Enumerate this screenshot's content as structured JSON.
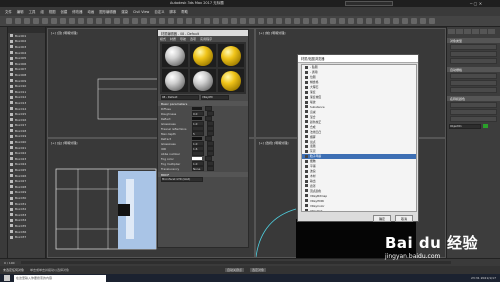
{
  "window": {
    "title": "Autodesk 3ds Max 2017   无标题",
    "search_placeholder": "键入关键字或短语"
  },
  "menu": [
    "文件",
    "编辑",
    "工具",
    "组",
    "视图",
    "创建",
    "修改器",
    "动画",
    "图形编辑器",
    "渲染",
    "Civil View",
    "自定义",
    "脚本",
    "帮助"
  ],
  "scene_explorer": {
    "items": [
      "Box001",
      "Box002",
      "Box003",
      "Box004",
      "Box005",
      "Box006",
      "Box007",
      "Box008",
      "Box009",
      "Box010",
      "Box011",
      "Box012",
      "Box013",
      "Box014",
      "Box015",
      "Box016",
      "Box017",
      "Box018",
      "Box019",
      "Box020",
      "Box021",
      "Box022",
      "Box023",
      "Box024",
      "Box025",
      "Box026",
      "Box027",
      "Box028",
      "Box029",
      "Box030",
      "Box031",
      "Box032",
      "Box033",
      "Box034",
      "Box035",
      "Box036",
      "Box037"
    ]
  },
  "viewports": {
    "top": "[+] [顶] [明暗处理]",
    "front": "[+] [前] [明暗处理]",
    "left": "[+] [左] [明暗处理]",
    "perspective": "[+] [透视] [明暗处理]"
  },
  "material_editor": {
    "title": "材质编辑器 - 08 - Default",
    "menu": [
      "模式",
      "材质",
      "导航",
      "选项",
      "实用程序"
    ],
    "slots": [
      "gray",
      "gold",
      "gold",
      "gray",
      "gray",
      "gold"
    ],
    "material_name": "08 - Default",
    "material_type": "VRayMtl",
    "rollout_basic": "Basic parameters",
    "params": [
      {
        "label": "Diffuse",
        "value": "",
        "swatch": "#1a1a1a"
      },
      {
        "label": "Roughness",
        "value": "0.0"
      },
      {
        "label": "Reflect",
        "value": "",
        "swatch": "#111111"
      },
      {
        "label": "Glossiness",
        "value": "1.0"
      },
      {
        "label": "Fresnel reflections",
        "value": ""
      },
      {
        "label": "Max depth",
        "value": "5"
      },
      {
        "label": "Refract",
        "value": "",
        "swatch": "#101010"
      },
      {
        "label": "Glossiness",
        "value": "1.0"
      },
      {
        "label": "IOR",
        "value": "1.6"
      },
      {
        "label": "Abbe number",
        "value": ""
      },
      {
        "label": "Fog color",
        "value": "",
        "swatch": "#ffffff"
      },
      {
        "label": "Fog multiplier",
        "value": "1.0"
      },
      {
        "label": "Translucency",
        "value": "None"
      }
    ],
    "rollout_brdf": "BRDF",
    "brdf_type": "Microfacet GTR (GGX)"
  },
  "map_browser": {
    "title": "材质/贴图浏览器",
    "search_placeholder": "按名称搜索...",
    "items": [
      "- 贴图",
      "- 通用",
      "位图",
      "棋盘格",
      "大理石",
      "渐变",
      "渐变坡度",
      "噪波",
      "Substance",
      "衰减",
      "混合",
      "颜色校正",
      "合成",
      "法线凹凸",
      "烟雾",
      "斑点",
      "泼溅",
      "灰泥",
      "粒子年龄",
      "细胞",
      "平铺",
      "波浪",
      "木材",
      "输出",
      "遮罩",
      "顶点颜色",
      "VRayBitmap",
      "VRayHDRI",
      "VRayColor",
      "VRayDirt",
      "VRayEdgesTex",
      "VRayNormalMap",
      "VRaySky",
      "VRayCompTex",
      "- 场景材质",
      "- 示例窗",
      "08 - Default"
    ],
    "selected_index": 18,
    "ok_label": "确定",
    "cancel_label": "取消"
  },
  "command_panel": {
    "tabs": [
      "创建",
      "修改",
      "层次",
      "运动",
      "显示",
      "实用"
    ],
    "rollouts": [
      "对象类型",
      "自动栅格",
      "名称和颜色"
    ],
    "name_value": "Object01"
  },
  "timeline": {
    "frame": "0 / 100"
  },
  "status": {
    "selection": "未选定任何对象",
    "prompt": "单击或单击并拖动以选择对象",
    "autokey": "自动关键点",
    "selected": "选定对象"
  },
  "taskbar": {
    "search": "在这里输入你要搜索的内容",
    "time": "23:31",
    "date": "2021/1/17"
  },
  "watermark": {
    "logo": "Bai du 经验",
    "url": "jingyan.baidu.com"
  },
  "colors": {
    "selection_blue": "#3d6fb4",
    "ui_dark": "#3d3d3d",
    "accent_cyan": "#4fd0e0"
  }
}
